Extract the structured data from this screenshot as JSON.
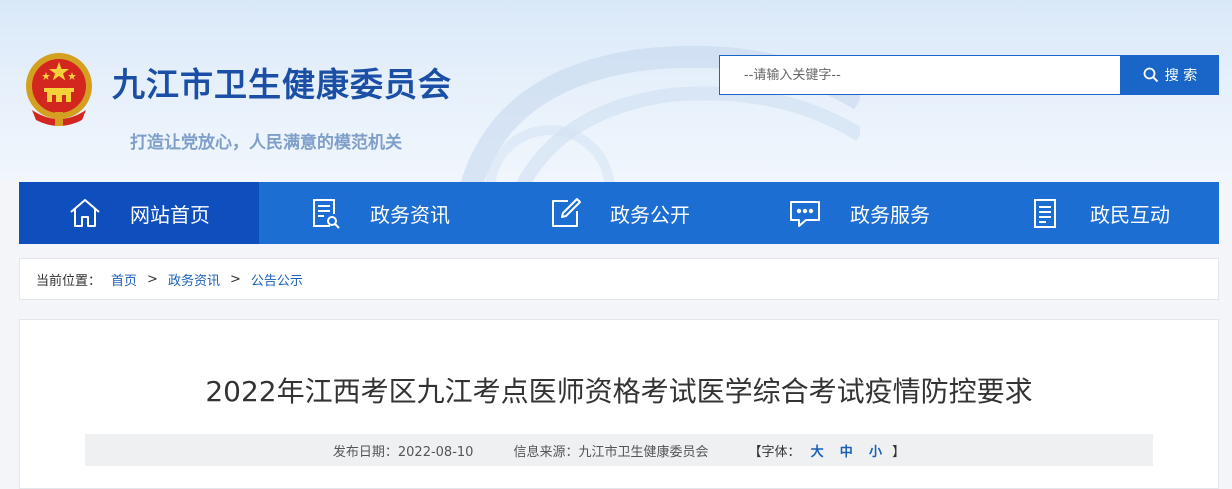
{
  "header": {
    "site_title": "九江市卫生健康委员会",
    "slogan": "打造让党放心，人民满意的模范机关",
    "emblem_icon": "national-emblem-icon"
  },
  "search": {
    "placeholder": "--请输入关键字--",
    "button_label": "搜 索"
  },
  "nav": {
    "items": [
      {
        "label": "网站首页",
        "icon": "home-icon",
        "active": true
      },
      {
        "label": "政务资讯",
        "icon": "document-search-icon",
        "active": false
      },
      {
        "label": "政务公开",
        "icon": "edit-icon",
        "active": false
      },
      {
        "label": "政务服务",
        "icon": "chat-icon",
        "active": false
      },
      {
        "label": "政民互动",
        "icon": "clipboard-icon",
        "active": false
      }
    ]
  },
  "breadcrumb": {
    "prefix": "当前位置：",
    "items": [
      "首页",
      "政务资讯",
      "公告公示"
    ],
    "separator": ">"
  },
  "article": {
    "title": "2022年江西考区九江考点医师资格考试医学综合考试疫情防控要求",
    "publish_date": "发布日期：2022-08-10",
    "source": "信息来源：九江市卫生健康委员会",
    "font_size_label_open": "【字体：",
    "font_size_options": [
      "大",
      "中",
      "小"
    ],
    "font_size_label_close": "】"
  },
  "colors": {
    "nav_bg": "#1d6ed3",
    "nav_active": "#0f4fbd",
    "title_blue": "#1b4fa6",
    "link_blue": "#1a5fb8"
  }
}
